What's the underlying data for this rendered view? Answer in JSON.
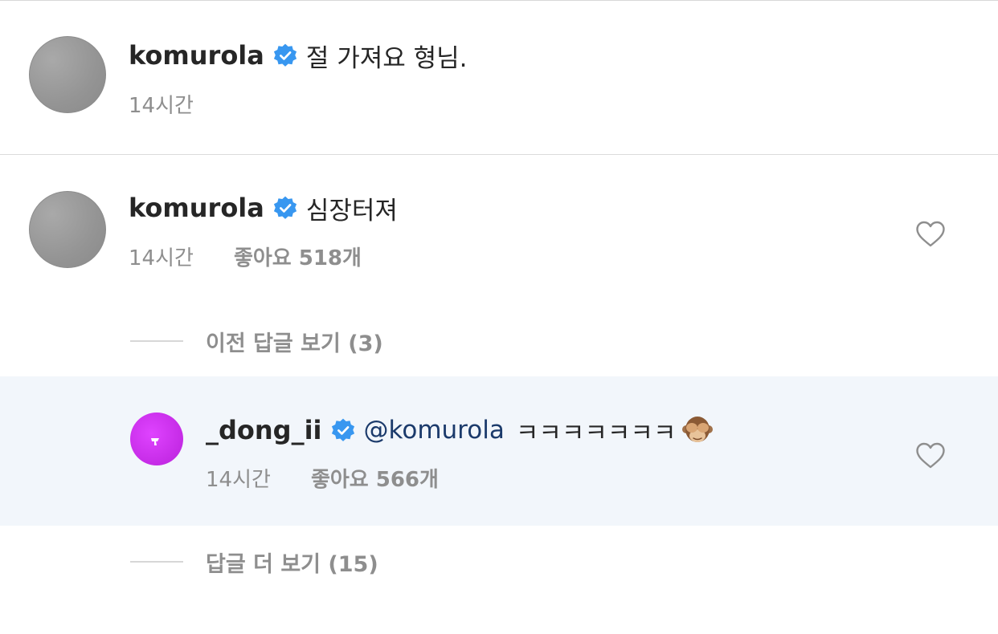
{
  "colors": {
    "verified_blue": "#3897f0",
    "mention_text": "#1b3a6b",
    "meta_gray": "#8e8e8e",
    "highlight_bg": "#f2f6fb"
  },
  "comments": [
    {
      "username": "komurola",
      "verified": true,
      "text": "절 가져요 형님.",
      "time": "14시간",
      "likes": ""
    },
    {
      "username": "komurola",
      "verified": true,
      "text": "심장터져",
      "time": "14시간",
      "likes": "좋아요 518개"
    }
  ],
  "reply_toggles": {
    "previous": "이전 답글 보기 (3)",
    "more": "답글 더 보기 (15)"
  },
  "reply": {
    "username": "_dong_ii",
    "verified": true,
    "mention": "@komurola",
    "text": "ㅋㅋㅋㅋㅋㅋㅋ",
    "emoji": "see-no-evil-monkey",
    "time": "14시간",
    "likes": "좋아요 566개"
  }
}
